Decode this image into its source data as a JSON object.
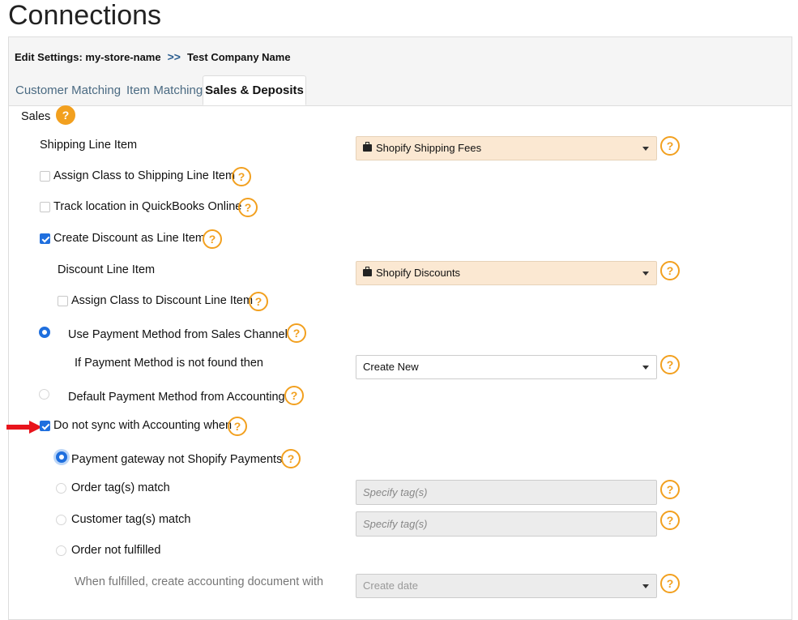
{
  "page": {
    "title": "Connections"
  },
  "breadcrumb": {
    "prefix": "Edit Settings: my-store-name",
    "separator": ">>",
    "company": "Test Company Name"
  },
  "tabs": [
    {
      "label": "Customer Matching",
      "active": false
    },
    {
      "label": "Item Matching",
      "active": false
    },
    {
      "label": "Sales & Deposits",
      "active": true
    }
  ],
  "help_glyph": "?",
  "sales": {
    "section_label": "Sales",
    "shipping_line_item": {
      "label": "Shipping Line Item",
      "value": "Shopify Shipping Fees"
    },
    "assign_class_shipping": {
      "label": "Assign Class to Shipping Line Item",
      "checked": false
    },
    "track_location": {
      "label": "Track location in QuickBooks Online",
      "checked": false
    },
    "create_discount": {
      "label": "Create Discount as Line Item",
      "checked": true
    },
    "discount_line_item": {
      "label": "Discount Line Item",
      "value": "Shopify Discounts"
    },
    "assign_class_discount": {
      "label": "Assign Class to Discount Line Item",
      "checked": false
    },
    "payment_method_channel": {
      "label": "Use Payment Method from Sales Channel",
      "selected": true
    },
    "payment_not_found": {
      "label": "If Payment Method is not found then",
      "value": "Create New"
    },
    "payment_method_default": {
      "label": "Default Payment Method from Accounting",
      "selected": false
    },
    "do_not_sync": {
      "label": "Do not sync with Accounting when",
      "checked": true
    },
    "gateway_not_shopify": {
      "label": "Payment gateway not Shopify Payments",
      "selected": true
    },
    "order_tags": {
      "label": "Order tag(s) match",
      "selected": false,
      "placeholder": "Specify tag(s)"
    },
    "customer_tags": {
      "label": "Customer tag(s) match",
      "selected": false,
      "placeholder": "Specify tag(s)"
    },
    "order_not_fulfilled": {
      "label": "Order not fulfilled",
      "selected": false
    },
    "when_fulfilled": {
      "label": "When fulfilled, create accounting document with",
      "value": "Create date"
    }
  },
  "colors": {
    "accent": "#1f6fde",
    "help": "#f2a01f",
    "highlight_select": "#fbe8d2",
    "pointer_arrow": "#e8141c"
  }
}
